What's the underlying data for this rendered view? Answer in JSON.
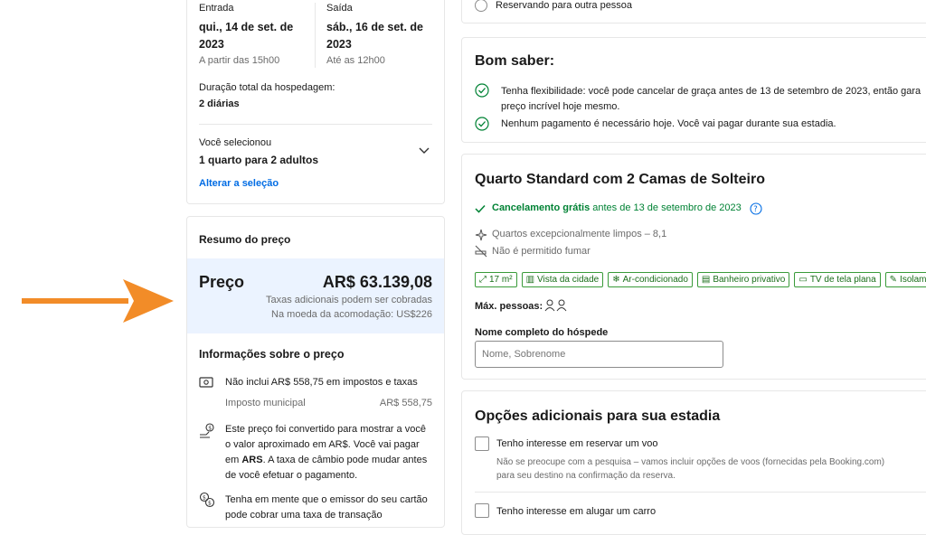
{
  "stay": {
    "checkin_label": "Entrada",
    "checkin_date_line1": "qui., 14 de set. de",
    "checkin_date_line2": "2023",
    "checkin_time": "A partir das 15h00",
    "checkout_label": "Saída",
    "checkout_date_line1": "sáb., 16 de set. de",
    "checkout_date_line2": "2023",
    "checkout_time": "Até as 12h00",
    "duration_label": "Duração total da hospedagem:",
    "duration_value": "2 diárias",
    "selected_label": "Você selecionou",
    "selected_value": "1 quarto para 2 adultos",
    "change_link": "Alterar a seleção"
  },
  "price_summary": {
    "title": "Resumo do preço",
    "price_label": "Preço",
    "price_value": "AR$ 63.139,08",
    "taxes_note": "Taxas adicionais podem ser cobradas",
    "currency_note": "Na moeda da acomodação: US$226"
  },
  "price_info": {
    "title": "Informações sobre o preço",
    "tax_excluded": "Não inclui AR$ 558,75 em impostos e taxas",
    "municipal_tax_label": "Imposto municipal",
    "municipal_tax_value": "AR$ 558,75",
    "conversion_line1": "Este preço foi convertido para mostrar a você",
    "conversion_line2": "o valor aproximado em AR$. Você vai pagar",
    "conversion_line3_pre": "em ",
    "conversion_line3_bold": "ARS",
    "conversion_line3_post": ". A taxa de câmbio pode mudar antes",
    "conversion_line4": "de você efetuar o pagamento.",
    "card_fee_line1": "Tenha em mente que o emissor do seu cartão",
    "card_fee_line2": "pode cobrar uma taxa de transação"
  },
  "booking_for": {
    "other_person": "Reservando para outra pessoa"
  },
  "good_to_know": {
    "title": "Bom saber:",
    "item1_line1": "Tenha flexibilidade: você pode cancelar de graça antes de 13 de setembro de 2023, então gara",
    "item1_line2": "preço incrível hoje mesmo.",
    "item2": "Nenhum pagamento é necessário hoje. Você vai pagar durante sua estadia."
  },
  "room": {
    "title": "Quarto Standard com 2 Camas de Solteiro",
    "cancel_bold": "Cancelamento grátis",
    "cancel_rest": " antes de 13 de setembro de 2023",
    "clean": "Quartos excepcionalmente limpos – 8,1",
    "no_smoking": "Não é permitido fumar",
    "amenities": [
      "17 m²",
      "Vista da cidade",
      "Ar-condicionado",
      "Banheiro privativo",
      "TV de tela plana",
      "Isolame"
    ],
    "max_people_label": "Máx. pessoas:",
    "guest_name_label": "Nome completo do hóspede",
    "guest_name_placeholder": "Nome, Sobrenome"
  },
  "extras": {
    "title": "Opções adicionais para sua estadia",
    "flight_label": "Tenho interesse em reservar um voo",
    "flight_note_line1": "Não se preocupe com a pesquisa – vamos incluir opções de voos (fornecidas pela Booking.com)",
    "flight_note_line2": "para seu destino na confirmação da reserva.",
    "car_label": "Tenho interesse em alugar um carro"
  },
  "colors": {
    "arrow": "#f28c28",
    "price_highlight": "#ebf3ff",
    "link": "#006ce4",
    "success": "#008234"
  }
}
